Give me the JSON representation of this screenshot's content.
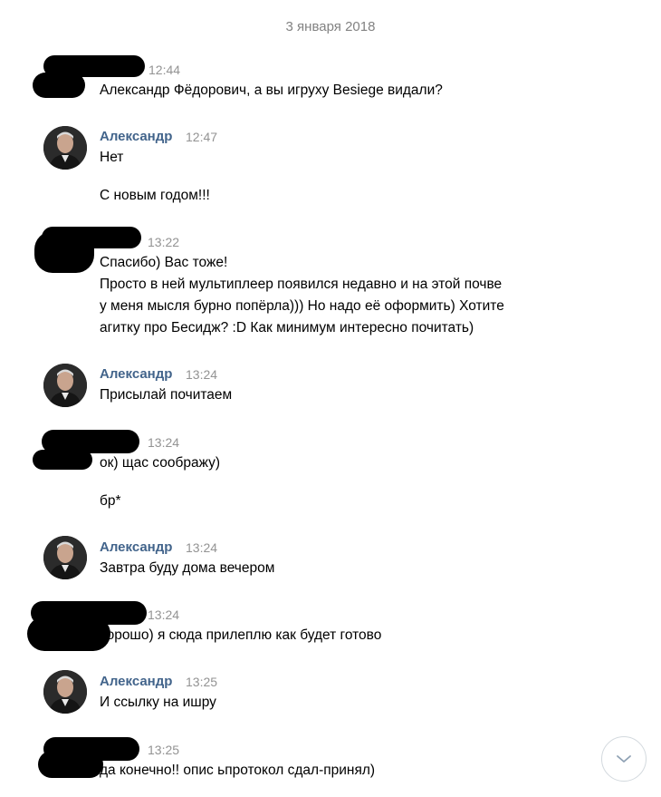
{
  "date_separator": "3 января 2018",
  "messages": [
    {
      "sender": "",
      "time": "12:44",
      "lines": [
        "Александр Фёдорович, а вы игруху Besiege видали?"
      ]
    },
    {
      "sender": "Александр",
      "time": "12:47",
      "lines": [
        "Нет"
      ]
    },
    {
      "sender": "",
      "time": "",
      "lines": [
        "С новым годом!!!"
      ]
    },
    {
      "sender": "",
      "time": "13:22",
      "lines": [
        "Спасибо) Вас тоже!",
        "Просто в ней мультиплеер появился недавно и на этой почве",
        "у меня мысля бурно попёрла))) Но надо её оформить) Хотите",
        "агитку про Бесидж? :D Как минимум интересно почитать)"
      ]
    },
    {
      "sender": "Александр",
      "time": "13:24",
      "lines": [
        "Присылай почитаем"
      ]
    },
    {
      "sender": "",
      "time": "13:24",
      "lines": [
        "ок) щас соображу)"
      ]
    },
    {
      "sender": "",
      "time": "",
      "lines": [
        "бр*"
      ]
    },
    {
      "sender": "Александр",
      "time": "13:24",
      "lines": [
        "Завтра буду дома вечером"
      ]
    },
    {
      "sender": "",
      "time": "13:24",
      "lines": [
        "хорошо) я сюда прилеплю как будет готово"
      ]
    },
    {
      "sender": "Александр",
      "time": "13:25",
      "lines": [
        "И ссылку на ишру"
      ]
    },
    {
      "sender": "",
      "time": "13:25",
      "lines": [
        "да конечно!! опис ьпротокол сдал-принял)"
      ]
    }
  ],
  "icons": {
    "avatar": "user-photo",
    "scroll": "chevron-down-icon"
  },
  "colors": {
    "sender": "#42648b",
    "time": "#939393",
    "date": "#828282",
    "redaction": "#000000"
  }
}
